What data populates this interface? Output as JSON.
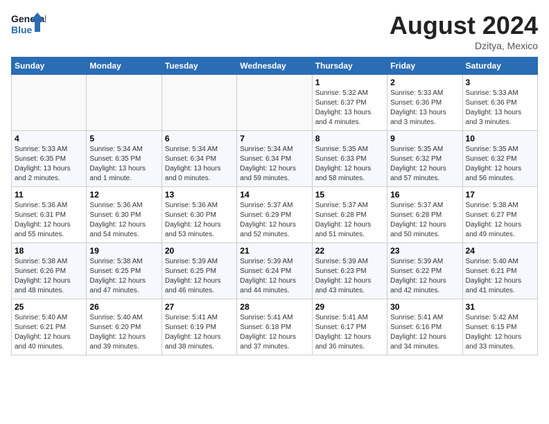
{
  "header": {
    "logo_line1": "General",
    "logo_line2": "Blue",
    "month_year": "August 2024",
    "location": "Dzitya, Mexico"
  },
  "days_of_week": [
    "Sunday",
    "Monday",
    "Tuesday",
    "Wednesday",
    "Thursday",
    "Friday",
    "Saturday"
  ],
  "weeks": [
    [
      {
        "num": "",
        "info": ""
      },
      {
        "num": "",
        "info": ""
      },
      {
        "num": "",
        "info": ""
      },
      {
        "num": "",
        "info": ""
      },
      {
        "num": "1",
        "info": "Sunrise: 5:32 AM\nSunset: 6:37 PM\nDaylight: 13 hours\nand 4 minutes."
      },
      {
        "num": "2",
        "info": "Sunrise: 5:33 AM\nSunset: 6:36 PM\nDaylight: 13 hours\nand 3 minutes."
      },
      {
        "num": "3",
        "info": "Sunrise: 5:33 AM\nSunset: 6:36 PM\nDaylight: 13 hours\nand 3 minutes."
      }
    ],
    [
      {
        "num": "4",
        "info": "Sunrise: 5:33 AM\nSunset: 6:35 PM\nDaylight: 13 hours\nand 2 minutes."
      },
      {
        "num": "5",
        "info": "Sunrise: 5:34 AM\nSunset: 6:35 PM\nDaylight: 13 hours\nand 1 minute."
      },
      {
        "num": "6",
        "info": "Sunrise: 5:34 AM\nSunset: 6:34 PM\nDaylight: 13 hours\nand 0 minutes."
      },
      {
        "num": "7",
        "info": "Sunrise: 5:34 AM\nSunset: 6:34 PM\nDaylight: 12 hours\nand 59 minutes."
      },
      {
        "num": "8",
        "info": "Sunrise: 5:35 AM\nSunset: 6:33 PM\nDaylight: 12 hours\nand 58 minutes."
      },
      {
        "num": "9",
        "info": "Sunrise: 5:35 AM\nSunset: 6:32 PM\nDaylight: 12 hours\nand 57 minutes."
      },
      {
        "num": "10",
        "info": "Sunrise: 5:35 AM\nSunset: 6:32 PM\nDaylight: 12 hours\nand 56 minutes."
      }
    ],
    [
      {
        "num": "11",
        "info": "Sunrise: 5:36 AM\nSunset: 6:31 PM\nDaylight: 12 hours\nand 55 minutes."
      },
      {
        "num": "12",
        "info": "Sunrise: 5:36 AM\nSunset: 6:30 PM\nDaylight: 12 hours\nand 54 minutes."
      },
      {
        "num": "13",
        "info": "Sunrise: 5:36 AM\nSunset: 6:30 PM\nDaylight: 12 hours\nand 53 minutes."
      },
      {
        "num": "14",
        "info": "Sunrise: 5:37 AM\nSunset: 6:29 PM\nDaylight: 12 hours\nand 52 minutes."
      },
      {
        "num": "15",
        "info": "Sunrise: 5:37 AM\nSunset: 6:28 PM\nDaylight: 12 hours\nand 51 minutes."
      },
      {
        "num": "16",
        "info": "Sunrise: 5:37 AM\nSunset: 6:28 PM\nDaylight: 12 hours\nand 50 minutes."
      },
      {
        "num": "17",
        "info": "Sunrise: 5:38 AM\nSunset: 6:27 PM\nDaylight: 12 hours\nand 49 minutes."
      }
    ],
    [
      {
        "num": "18",
        "info": "Sunrise: 5:38 AM\nSunset: 6:26 PM\nDaylight: 12 hours\nand 48 minutes."
      },
      {
        "num": "19",
        "info": "Sunrise: 5:38 AM\nSunset: 6:25 PM\nDaylight: 12 hours\nand 47 minutes."
      },
      {
        "num": "20",
        "info": "Sunrise: 5:39 AM\nSunset: 6:25 PM\nDaylight: 12 hours\nand 46 minutes."
      },
      {
        "num": "21",
        "info": "Sunrise: 5:39 AM\nSunset: 6:24 PM\nDaylight: 12 hours\nand 44 minutes."
      },
      {
        "num": "22",
        "info": "Sunrise: 5:39 AM\nSunset: 6:23 PM\nDaylight: 12 hours\nand 43 minutes."
      },
      {
        "num": "23",
        "info": "Sunrise: 5:39 AM\nSunset: 6:22 PM\nDaylight: 12 hours\nand 42 minutes."
      },
      {
        "num": "24",
        "info": "Sunrise: 5:40 AM\nSunset: 6:21 PM\nDaylight: 12 hours\nand 41 minutes."
      }
    ],
    [
      {
        "num": "25",
        "info": "Sunrise: 5:40 AM\nSunset: 6:21 PM\nDaylight: 12 hours\nand 40 minutes."
      },
      {
        "num": "26",
        "info": "Sunrise: 5:40 AM\nSunset: 6:20 PM\nDaylight: 12 hours\nand 39 minutes."
      },
      {
        "num": "27",
        "info": "Sunrise: 5:41 AM\nSunset: 6:19 PM\nDaylight: 12 hours\nand 38 minutes."
      },
      {
        "num": "28",
        "info": "Sunrise: 5:41 AM\nSunset: 6:18 PM\nDaylight: 12 hours\nand 37 minutes."
      },
      {
        "num": "29",
        "info": "Sunrise: 5:41 AM\nSunset: 6:17 PM\nDaylight: 12 hours\nand 36 minutes."
      },
      {
        "num": "30",
        "info": "Sunrise: 5:41 AM\nSunset: 6:16 PM\nDaylight: 12 hours\nand 34 minutes."
      },
      {
        "num": "31",
        "info": "Sunrise: 5:42 AM\nSunset: 6:15 PM\nDaylight: 12 hours\nand 33 minutes."
      }
    ]
  ]
}
